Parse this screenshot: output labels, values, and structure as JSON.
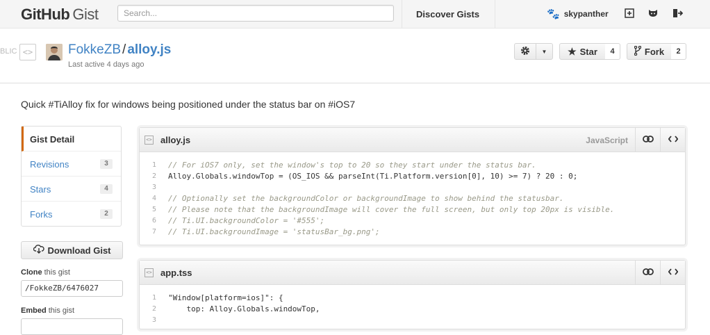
{
  "header": {
    "logo_github": "GitHub",
    "logo_gist": "Gist",
    "search_placeholder": "Search...",
    "discover_label": "Discover Gists",
    "username": "skypanther"
  },
  "gist": {
    "public_label": "BLIC",
    "owner": "FokkeZB",
    "separator": "/",
    "filename": "alloy.js",
    "last_active": "Last active 4 days ago",
    "star_label": "Star",
    "star_count": "4",
    "fork_label": "Fork",
    "fork_count": "2",
    "description": "Quick #TiAlloy fix for windows being positioned under the status bar on #iOS7"
  },
  "sidebar": {
    "items": [
      {
        "label": "Gist Detail",
        "count": ""
      },
      {
        "label": "Revisions",
        "count": "3"
      },
      {
        "label": "Stars",
        "count": "4"
      },
      {
        "label": "Forks",
        "count": "2"
      }
    ],
    "download_label": "Download Gist",
    "clone_bold": "Clone",
    "clone_rest": " this gist",
    "clone_url": "/FokkeZB/6476027",
    "embed_bold": "Embed",
    "embed_rest": " this gist"
  },
  "files": [
    {
      "name": "alloy.js",
      "language": "JavaScript",
      "lines": [
        {
          "n": "1",
          "text": "// For iOS7 only, set the window's top to 20 so they start under the status bar."
        },
        {
          "n": "2",
          "text": "Alloy.Globals.windowTop = (OS_IOS && parseInt(Ti.Platform.version[0], 10) >= 7) ? 20 : 0;"
        },
        {
          "n": "3",
          "text": ""
        },
        {
          "n": "4",
          "text": "// Optionally set the backgroundColor or backgroundImage to show behind the statusbar."
        },
        {
          "n": "5",
          "text": "// Please note that the backgroundImage will cover the full screen, but only top 20px is visible."
        },
        {
          "n": "6",
          "text": "// Ti.UI.backgroundColor = '#555';"
        },
        {
          "n": "7",
          "text": "// Ti.UI.backgroundImage = 'statusBar_bg.png';"
        }
      ]
    },
    {
      "name": "app.tss",
      "language": "",
      "lines": [
        {
          "n": "1",
          "text": "\"Window[platform=ios]\": {"
        },
        {
          "n": "2",
          "text": "    top: Alloy.Globals.windowTop,"
        },
        {
          "n": "3",
          "text": ""
        }
      ]
    }
  ],
  "colors": {
    "link": "#4183c4",
    "active_accent": "#d26911",
    "comment": "#999988",
    "function": "#0086b3"
  }
}
